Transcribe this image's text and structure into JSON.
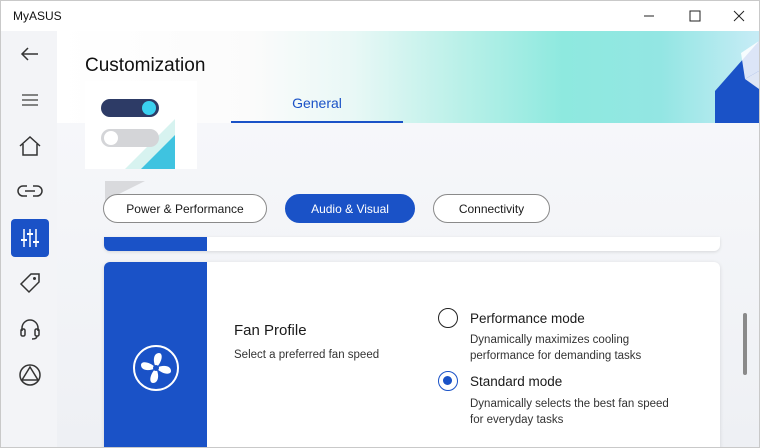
{
  "window": {
    "app_title": "MyASUS",
    "controls": {
      "minimize": "minimize",
      "maximize": "maximize",
      "close": "close"
    }
  },
  "header": {
    "title": "Customization",
    "tabs": [
      {
        "label": "General",
        "selected": true
      }
    ]
  },
  "sidebar": {
    "items": [
      {
        "icon": "back-arrow-icon",
        "active": false
      },
      {
        "icon": "menu-icon",
        "active": false
      },
      {
        "icon": "home-icon",
        "active": false
      },
      {
        "icon": "link-icon",
        "active": false
      },
      {
        "icon": "customization-sliders-icon",
        "active": true
      },
      {
        "icon": "tag-icon",
        "active": false
      },
      {
        "icon": "headset-icon",
        "active": false
      },
      {
        "icon": "triangle-circle-icon",
        "active": false
      }
    ]
  },
  "categories": [
    {
      "label": "Power & Performance",
      "active": false
    },
    {
      "label": "Audio & Visual",
      "active": true
    },
    {
      "label": "Connectivity",
      "active": false
    }
  ],
  "fan_profile": {
    "title": "Fan Profile",
    "subtitle": "Select a preferred fan speed",
    "icon": "fan-icon",
    "options": [
      {
        "label": "Performance mode",
        "description": "Dynamically maximizes cooling performance for demanding tasks",
        "selected": false
      },
      {
        "label": "Standard mode",
        "description": "Dynamically selects the best fan speed for everyday tasks",
        "selected": true
      }
    ]
  },
  "colors": {
    "accent": "#1a52c7",
    "banner_teal": "#8ee9df",
    "background": "#f3f4f7"
  }
}
